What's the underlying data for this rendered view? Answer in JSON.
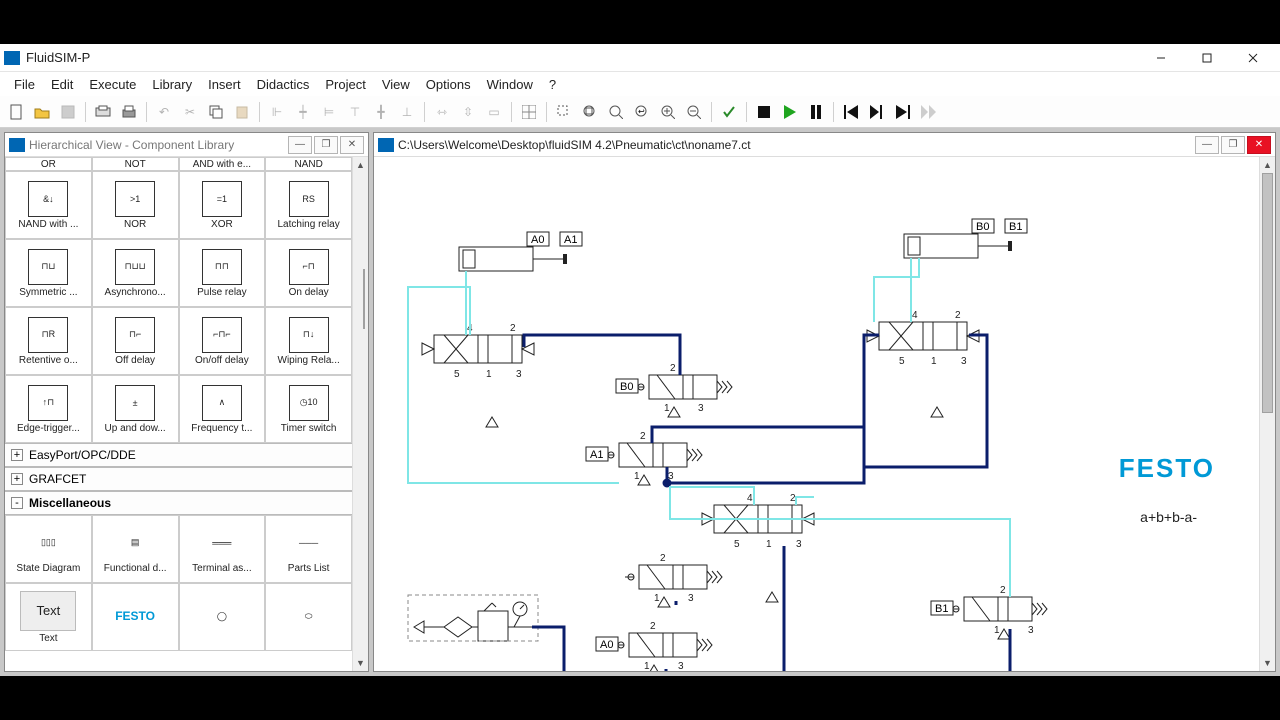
{
  "window_title": "FluidSIM-P",
  "menu": [
    "File",
    "Edit",
    "Execute",
    "Library",
    "Insert",
    "Didactics",
    "Project",
    "View",
    "Options",
    "Window",
    "?"
  ],
  "left_panel": {
    "title": "Hierarchical View - Component Library",
    "row0": [
      "OR",
      "NOT",
      "AND with e...",
      "NAND"
    ],
    "grid": [
      {
        "label": "NAND with ...",
        "g": "&↓"
      },
      {
        "label": "NOR",
        "g": ">1"
      },
      {
        "label": "XOR",
        "g": "=1"
      },
      {
        "label": "Latching relay",
        "g": "RS"
      },
      {
        "label": "Symmetric ...",
        "g": "⊓⊔"
      },
      {
        "label": "Asynchrono...",
        "g": "⊓⊔⊔"
      },
      {
        "label": "Pulse relay",
        "g": "⊓⊓"
      },
      {
        "label": "On delay",
        "g": "⌐⊓"
      },
      {
        "label": "Retentive o...",
        "g": "⊓R"
      },
      {
        "label": "Off delay",
        "g": "⊓⌐"
      },
      {
        "label": "On/off delay",
        "g": "⌐⊓⌐"
      },
      {
        "label": "Wiping Rela...",
        "g": "⊓↓"
      },
      {
        "label": "Edge-trigger...",
        "g": "↑⊓"
      },
      {
        "label": "Up and dow...",
        "g": "±"
      },
      {
        "label": "Frequency t...",
        "g": "∧"
      },
      {
        "label": "Timer switch",
        "g": "◷10"
      }
    ],
    "groups": [
      {
        "label": "EasyPort/OPC/DDE",
        "state": "+"
      },
      {
        "label": "GRAFCET",
        "state": "+"
      },
      {
        "label": "Miscellaneous",
        "state": "-"
      }
    ],
    "misc": [
      {
        "label": "State Diagram"
      },
      {
        "label": "Functional d..."
      },
      {
        "label": "Terminal as..."
      },
      {
        "label": "Parts List"
      },
      {
        "label": "Text"
      },
      {
        "label": ""
      },
      {
        "label": ""
      },
      {
        "label": ""
      }
    ]
  },
  "canvas": {
    "path": "C:\\Users\\Welcome\\Desktop\\fluidSIM 4.2\\Pneumatic\\ct\\noname7.ct",
    "brand": "FESTO",
    "sequence": "a+b+b-a-",
    "labels": {
      "A0": "A0",
      "A1": "A1",
      "B0": "B0",
      "B1": "B1",
      "B0r": "B0",
      "A1r": "A1",
      "A0r": "A0",
      "B1r": "B1"
    }
  }
}
